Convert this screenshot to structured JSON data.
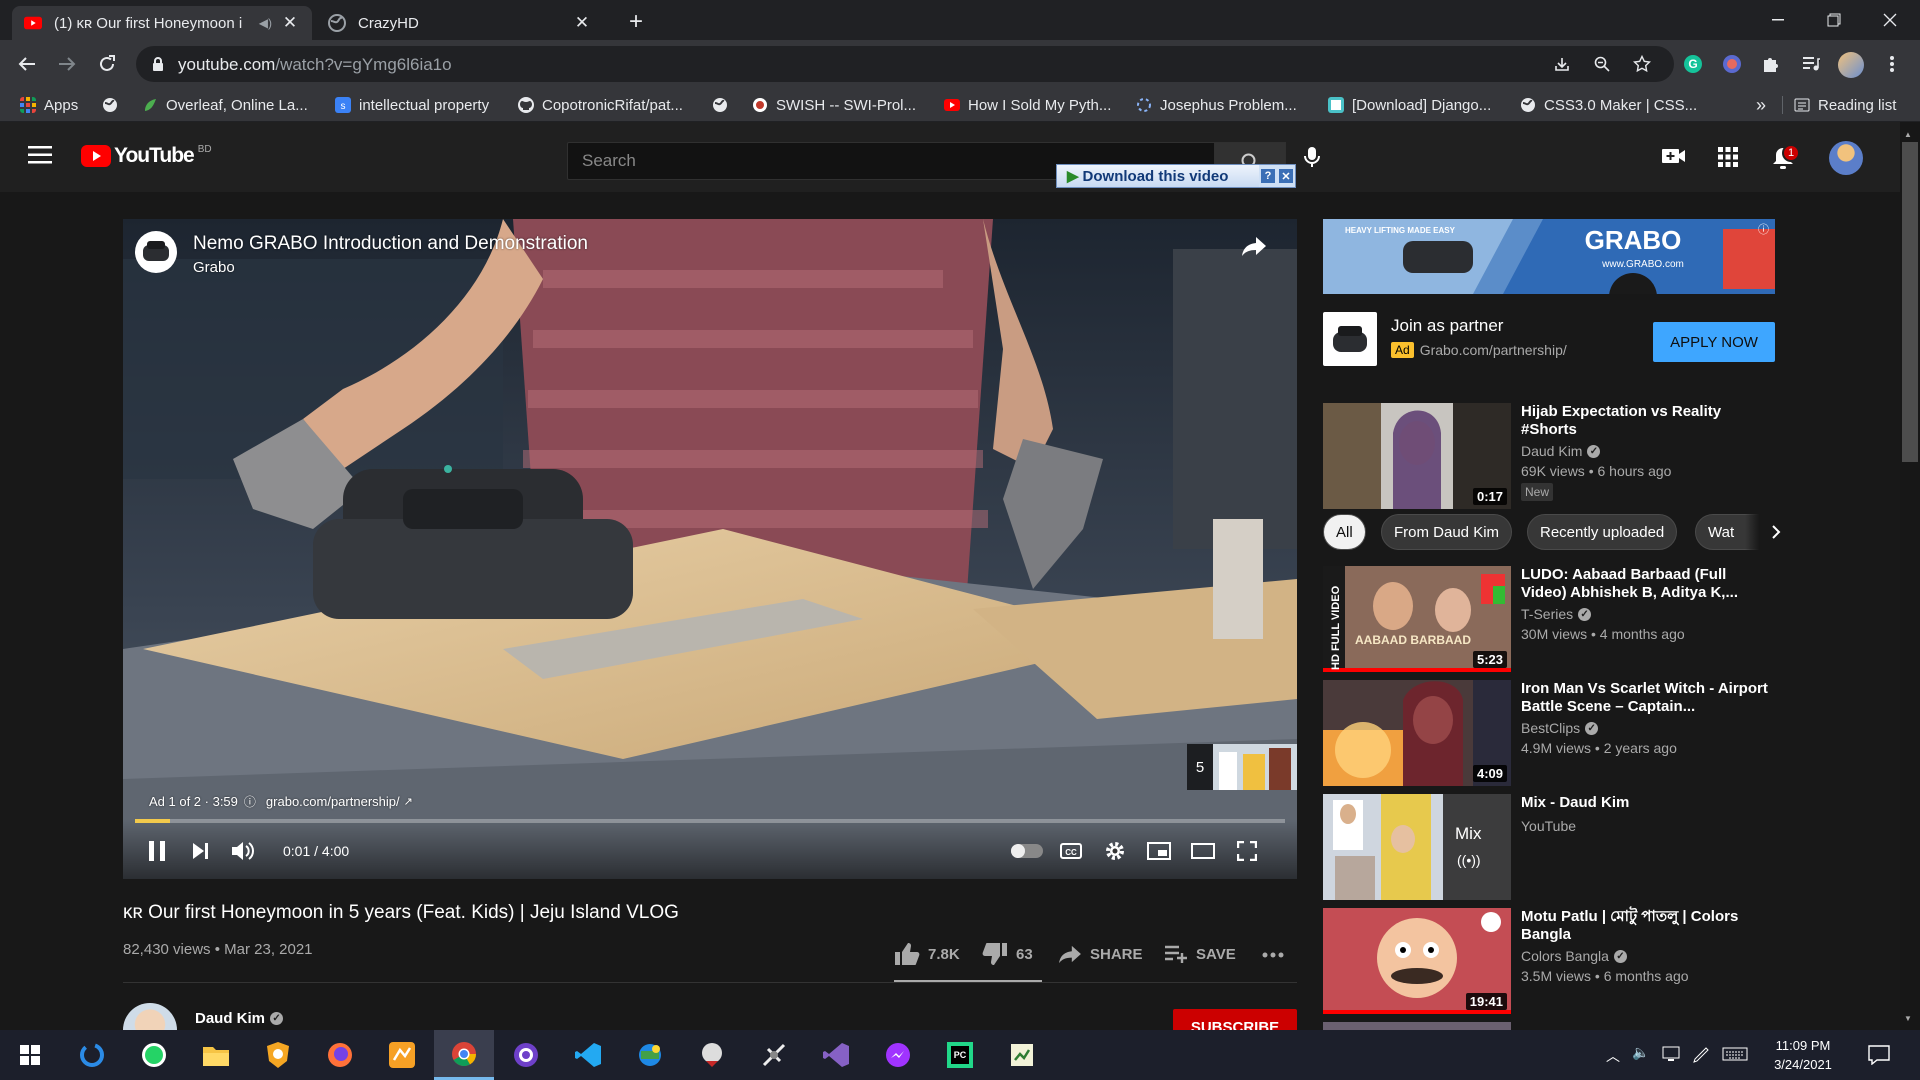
{
  "browser": {
    "tabs": [
      {
        "title": "(1) ᴋʀ Our first Honeymoon i",
        "active": true
      },
      {
        "title": "CrazyHD",
        "active": false
      }
    ],
    "url_host": "youtube.com",
    "url_path": "/watch?v=gYmg6l6ia1o",
    "bookmarks": [
      {
        "label": "Apps",
        "icon": "apps-grid-icon",
        "color": "#e8453c"
      },
      {
        "label": "",
        "icon": "globe-icon",
        "color": "#e8eaed"
      },
      {
        "label": "Overleaf, Online La...",
        "icon": "overleaf-icon",
        "color": "#4cae4f"
      },
      {
        "label": "intellectual property",
        "icon": "s-icon",
        "color": "#3b82f6"
      },
      {
        "label": "CopotronicRifat/pat...",
        "icon": "github-icon",
        "color": "#e8eaed"
      },
      {
        "label": "",
        "icon": "globe-icon",
        "color": "#e8eaed"
      },
      {
        "label": "SWISH -- SWI-Prol...",
        "icon": "swish-icon",
        "color": "#c0392b"
      },
      {
        "label": "How I Sold My Pyth...",
        "icon": "youtube-icon",
        "color": "#ff0000"
      },
      {
        "label": "Josephus Problem...",
        "icon": "loading-icon",
        "color": "#8ab4f8"
      },
      {
        "label": "[Download] Django...",
        "icon": "page-icon",
        "color": "#4ac1c7"
      },
      {
        "label": "CSS3.0 Maker | CSS...",
        "icon": "globe-icon",
        "color": "#e8eaed"
      }
    ],
    "bookmarks_overflow": "»",
    "reading_list": "Reading list"
  },
  "youtube": {
    "logo_text": "YouTube",
    "region": "BD",
    "search_placeholder": "Search",
    "download_label": "Download this video",
    "download_help": "?",
    "download_close": "✕",
    "notification_count": "1"
  },
  "player": {
    "ad_title": "Nemo GRABO Introduction and Demonstration",
    "ad_channel": "Grabo",
    "ad_info": "Ad 1 of 2 · 3:59",
    "ad_url": "grabo.com/partnership/",
    "time": "0:01 / 4:00",
    "queue_count": "5",
    "progress": 0.03
  },
  "video": {
    "title": "ᴋʀ Our first Honeymoon in 5 years (Feat. Kids) | Jeju Island VLOG",
    "meta": "82,430 views • Mar 23, 2021",
    "likes": "7.8K",
    "dislikes": "63",
    "share": "SHARE",
    "save": "SAVE",
    "channel": "Daud Kim",
    "subscribe": "SUBSCRIBE"
  },
  "ad_card": {
    "banner_text": "GRABO",
    "banner_site": "www.GRABO.com",
    "banner_tag": "HEAVY LIFTING MADE EASY",
    "title": "Join as partner",
    "badge": "Ad",
    "url": "Grabo.com/partnership/",
    "cta": "APPLY NOW"
  },
  "chips": [
    "All",
    "From Daud Kim",
    "Recently uploaded",
    "Wat"
  ],
  "recommendations": [
    {
      "title": "Hijab Expectation vs Reality #Shorts",
      "channel": "Daud Kim",
      "meta": "69K views • 6 hours ago",
      "badge": "New",
      "duration": "0:17"
    },
    {
      "title": "LUDO: Aabaad Barbaad (Full Video) Abhishek B, Aditya K,...",
      "channel": "T-Series",
      "meta": "30M views • 4 months ago",
      "duration": "5:23",
      "thumb_text": "AABAAD BARBAAD",
      "side_text": "HD FULL VIDEO"
    },
    {
      "title": "Iron Man Vs Scarlet Witch - Airport Battle Scene – Captain...",
      "channel": "BestClips",
      "meta": "4.9M views • 2 years ago",
      "duration": "4:09"
    },
    {
      "title": "Mix - Daud Kim",
      "channel": "YouTube",
      "meta": "",
      "mix_label": "Mix"
    },
    {
      "title": "Motu Patlu | মোটু পাতলু | Colors Bangla",
      "channel": "Colors Bangla",
      "meta": "3.5M views • 6 months ago",
      "duration": "19:41"
    }
  ],
  "taskbar": {
    "time": "11:09 PM",
    "date": "3/24/2021"
  }
}
